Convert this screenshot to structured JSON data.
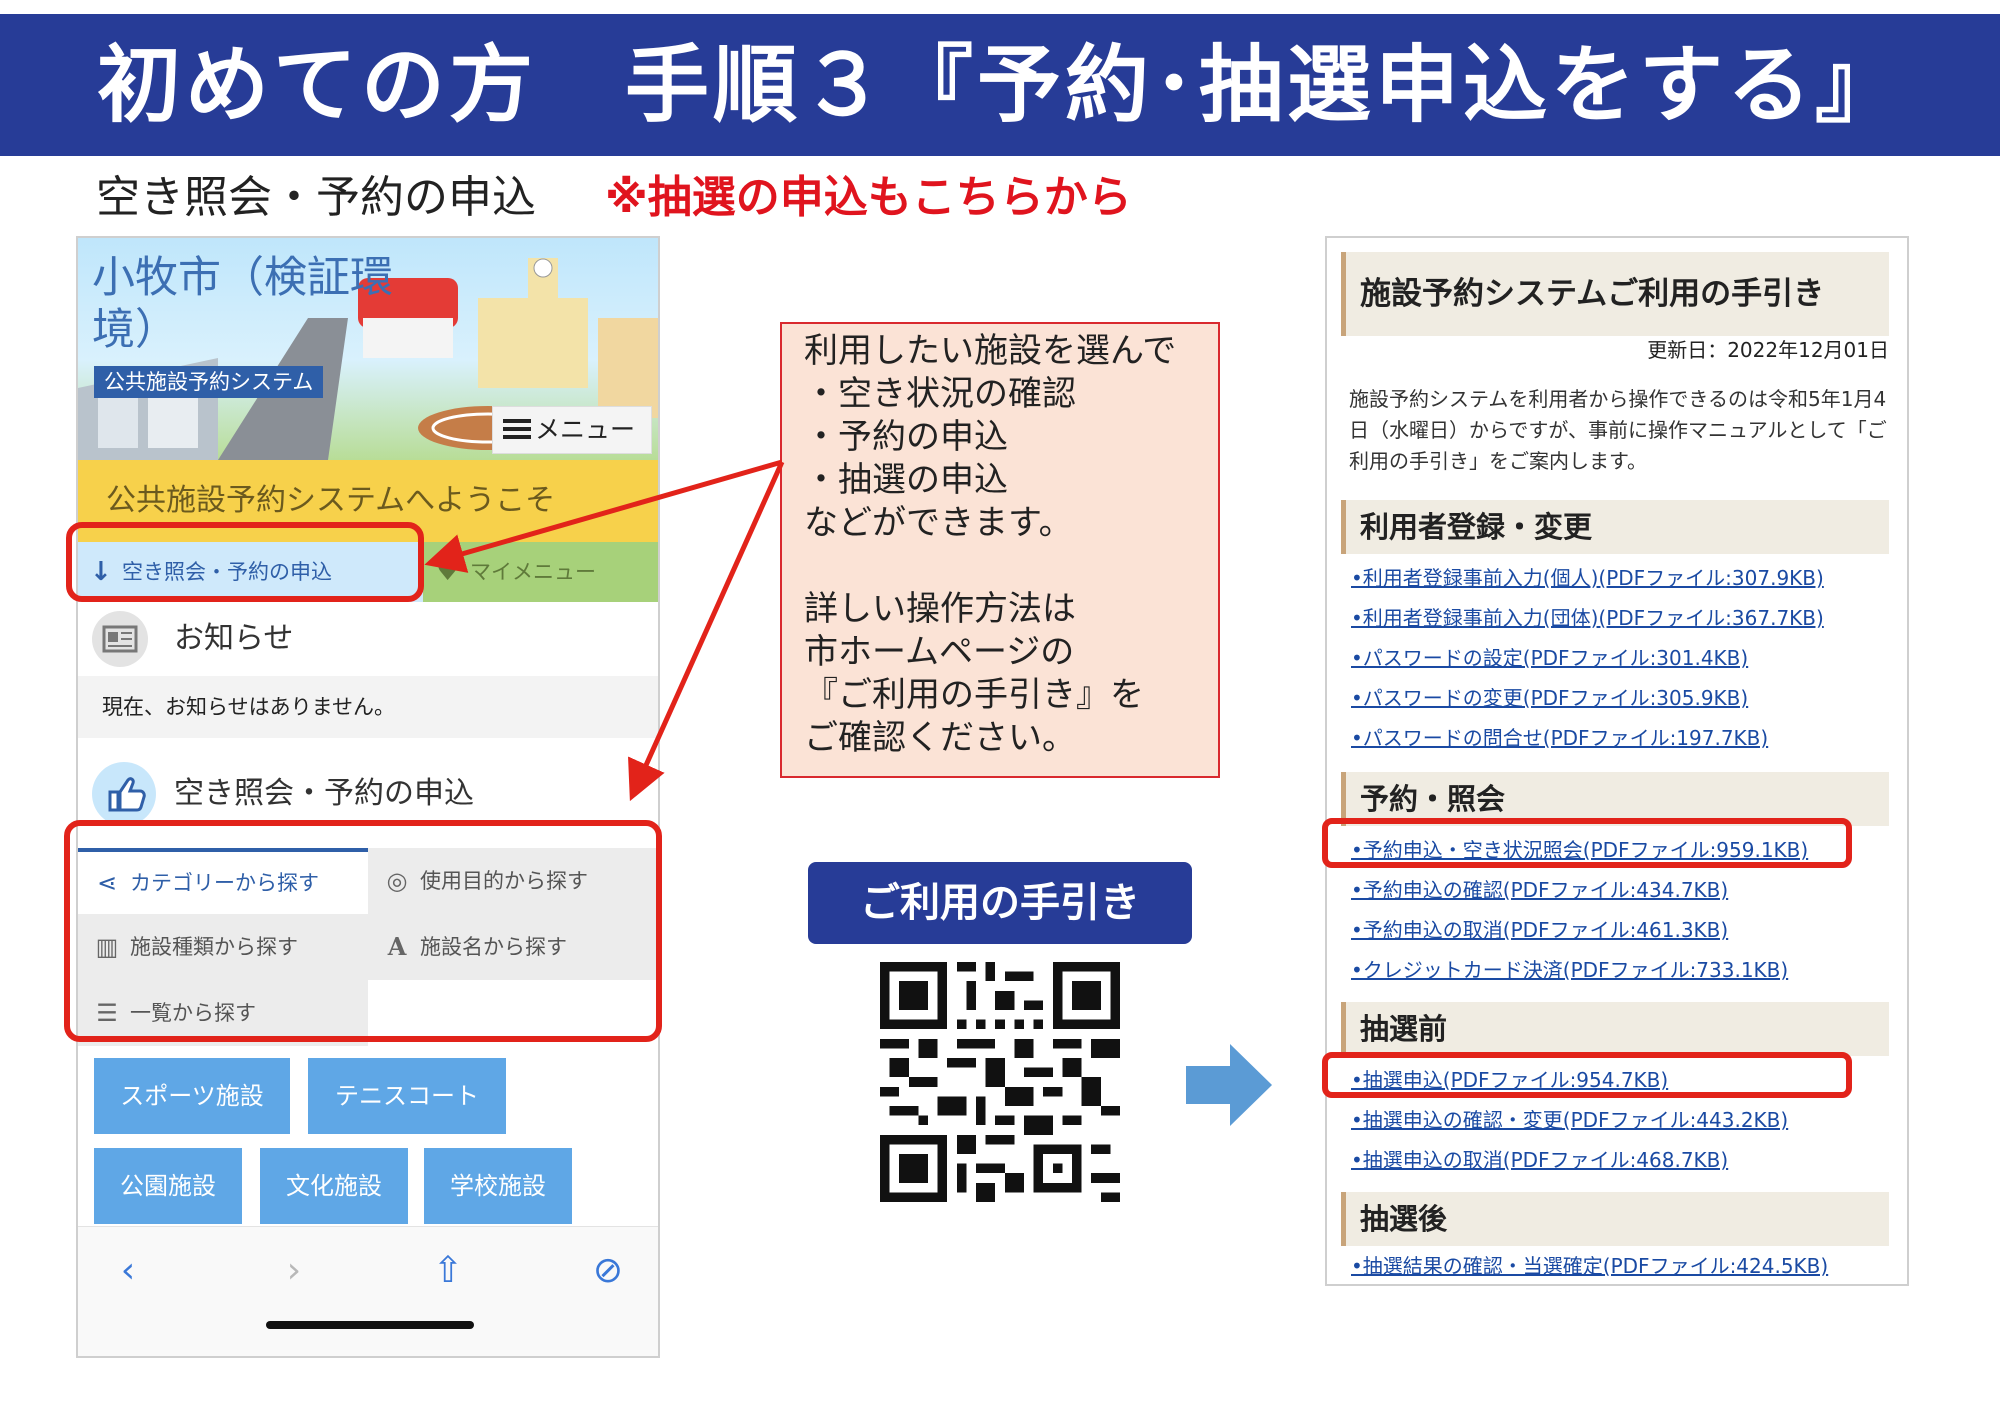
{
  "header": {
    "title": "初めての方　手順３『予約･抽選申込をする』",
    "subtitle": "空き照会・予約の申込",
    "subtitle_note": "※抽選の申込もこちらから"
  },
  "colors": {
    "banner": "#273c97",
    "highlight": "#e2231a",
    "accent_blue": "#2f5fa8"
  },
  "phone": {
    "app_title": "小牧市（検証環境）",
    "app_badge": "公共施設予約システム",
    "menu_label": "メニュー",
    "welcome": "公共施設予約システムへようこそ",
    "nav_left": "空き照会・予約の申込",
    "nav_right": "マイメニュー",
    "notice_title": "お知らせ",
    "notice_body": "現在、お知らせはありません。",
    "search_title": "空き照会・予約の申込",
    "tabs": [
      {
        "label": "カテゴリーから探す",
        "icon": "share-icon"
      },
      {
        "label": "使用目的から探す",
        "icon": "compass-icon"
      },
      {
        "label": "施設種類から探す",
        "icon": "bank-icon"
      },
      {
        "label": "施設名から探す",
        "icon": "font-icon"
      },
      {
        "label": "一覧から探す",
        "icon": "list-icon"
      }
    ],
    "categories": [
      "スポーツ施設",
      "テニスコート",
      "公園施設",
      "文化施設",
      "学校施設"
    ],
    "toolbar": {
      "back": "‹",
      "forward": "›",
      "share": "⇧",
      "compass": "⊘"
    }
  },
  "info_box": {
    "lines": [
      "利用したい施設を選んで",
      "・空き状況の確認",
      "・予約の申込",
      "・抽選の申込",
      "などができます。",
      "",
      "詳しい操作方法は",
      "市ホームページの",
      "『ご利用の手引き』を",
      "ご確認ください。"
    ]
  },
  "guide_button": "ご利用の手引き",
  "guide_page": {
    "title": "施設予約システムご利用の手引き",
    "updated": "更新日：2022年12月01日",
    "intro": "施設予約システムを利用者から操作できるのは令和5年1月4日（水曜日）からですが、事前に操作マニュアルとして「ご利用の手引き」をご案内します。",
    "sections": [
      {
        "title": "利用者登録・変更",
        "links": [
          "•利用者登録事前入力(個人)(PDFファイル:307.9KB)",
          "•利用者登録事前入力(団体)(PDFファイル:367.7KB)",
          "•パスワードの設定(PDFファイル:301.4KB)",
          "•パスワードの変更(PDFファイル:305.9KB)",
          "•パスワードの問合せ(PDFファイル:197.7KB)"
        ]
      },
      {
        "title": "予約・照会",
        "links": [
          "•予約申込・空き状況照会(PDFファイル:959.1KB)",
          "•予約申込の確認(PDFファイル:434.7KB)",
          "•予約申込の取消(PDFファイル:461.3KB)",
          "•クレジットカード決済(PDFファイル:733.1KB)"
        ]
      },
      {
        "title": "抽選前",
        "links": [
          "•抽選申込(PDFファイル:954.7KB)",
          "•抽選申込の確認・変更(PDFファイル:443.2KB)",
          "•抽選申込の取消(PDFファイル:468.7KB)"
        ]
      },
      {
        "title": "抽選後",
        "links": [
          "•抽選結果の確認・当選確定(PDFファイル:424.5KB)"
        ]
      }
    ]
  }
}
